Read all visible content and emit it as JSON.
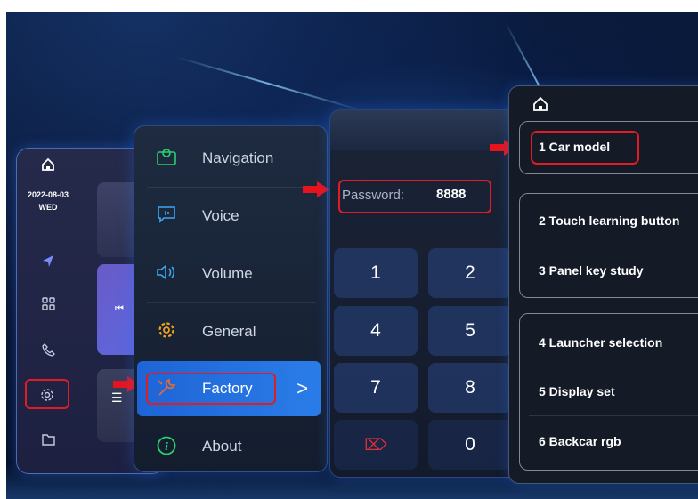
{
  "sidebar": {
    "date": "2022-08-03",
    "weekday": "WED",
    "icons": [
      "home-icon",
      "navigation-arrow-icon",
      "apps-grid-icon",
      "phone-icon",
      "settings-gear-icon",
      "folder-icon"
    ]
  },
  "menu": {
    "items": [
      {
        "label": "Navigation",
        "icon": "map-pin-icon"
      },
      {
        "label": "Voice",
        "icon": "voice-message-icon"
      },
      {
        "label": "Volume",
        "icon": "speaker-icon"
      },
      {
        "label": "General",
        "icon": "gear-icon"
      },
      {
        "label": "Factory",
        "icon": "tools-icon",
        "active": true
      },
      {
        "label": "About",
        "icon": "info-icon"
      }
    ],
    "chevron": ">"
  },
  "keypad": {
    "password_label": "Password:",
    "password_value": "8888",
    "keys": [
      "1",
      "2",
      "4",
      "5",
      "7",
      "8",
      "⌦",
      "0"
    ]
  },
  "factory": {
    "items": [
      "1  Car model",
      "2  Touch learning button",
      "3  Panel key study",
      "4  Launcher selection",
      "5  Display set",
      "6  Backcar rgb"
    ]
  },
  "colors": {
    "highlight": "#e01c24",
    "accent": "#1e64d6"
  }
}
